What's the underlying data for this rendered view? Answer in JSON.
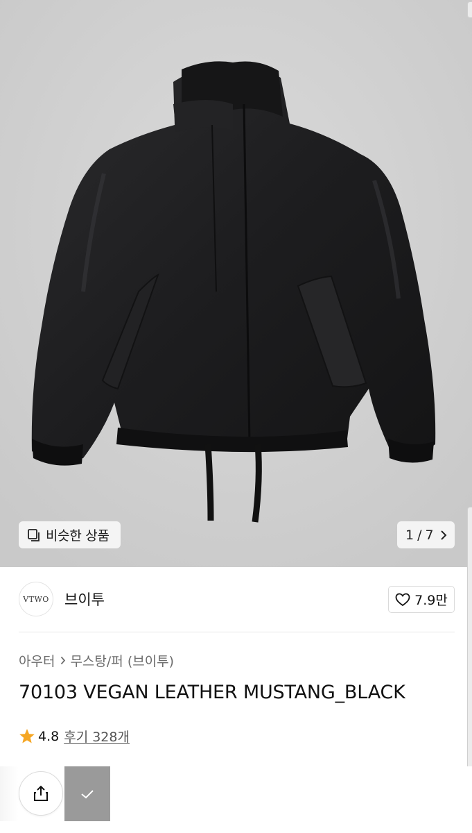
{
  "gallery": {
    "similar_label": "비슷한 상품",
    "page_current": "1",
    "page_separator": "/",
    "page_total": "7"
  },
  "brand": {
    "logo_text": "VTWO",
    "name": "브이투",
    "like_count": "7.9만"
  },
  "category": {
    "level1": "아우터",
    "level2": "무스탕/퍼 (브이투)"
  },
  "product": {
    "title": "70103 VEGAN LEATHER MUSTANG_BLACK",
    "rating": "4.8",
    "reviews_label": "후기 328개"
  },
  "colors": {
    "star": "#F5A623",
    "check_button": "#9A9A9A"
  }
}
